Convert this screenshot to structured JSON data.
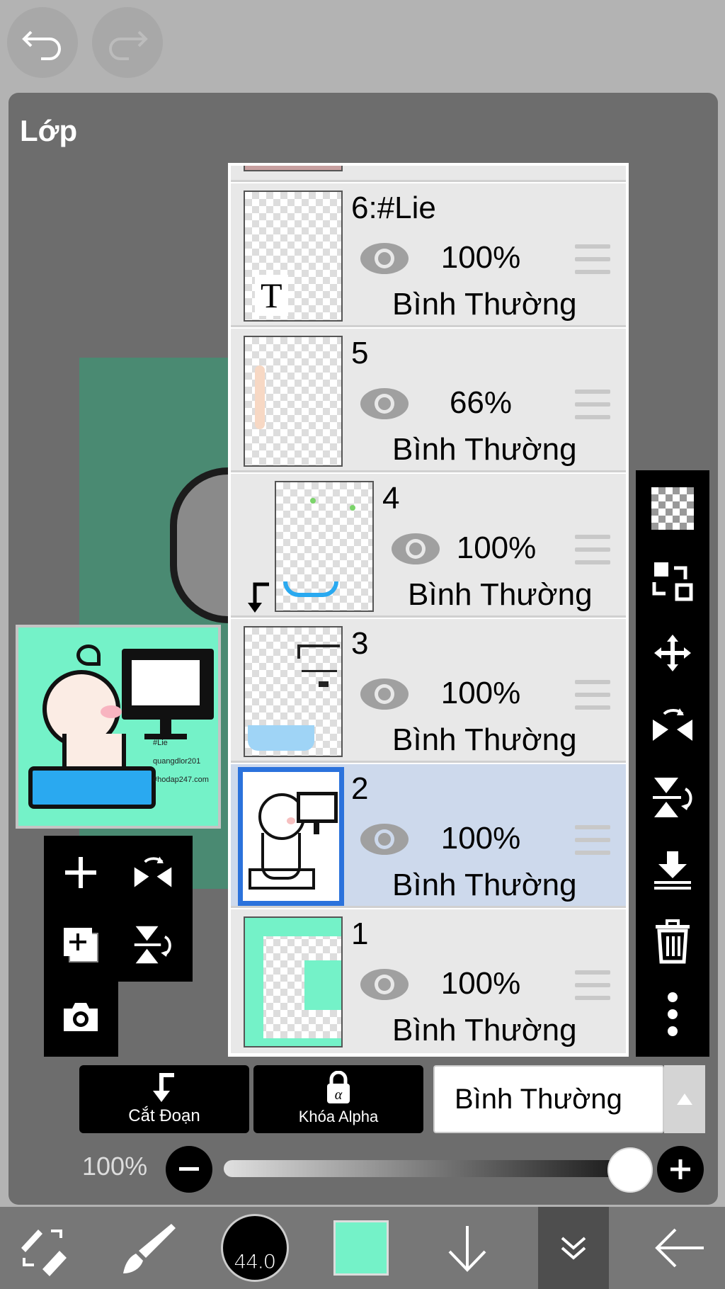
{
  "toolbar": {
    "undo_icon": "undo-icon",
    "redo_icon": "redo-icon"
  },
  "panel": {
    "title": "Lớp"
  },
  "layers": [
    {
      "name": "6:#Lie",
      "opacity": "100%",
      "blend": "Bình Thường",
      "selected": false,
      "clipped": false,
      "thumb_text": "T"
    },
    {
      "name": "5",
      "opacity": "66%",
      "blend": "Bình Thường",
      "selected": false,
      "clipped": false
    },
    {
      "name": "4",
      "opacity": "100%",
      "blend": "Bình Thường",
      "selected": false,
      "clipped": true
    },
    {
      "name": "3",
      "opacity": "100%",
      "blend": "Bình Thường",
      "selected": false,
      "clipped": false
    },
    {
      "name": "2",
      "opacity": "100%",
      "blend": "Bình Thường",
      "selected": true,
      "clipped": false
    },
    {
      "name": "1",
      "opacity": "100%",
      "blend": "Bình Thường",
      "selected": false,
      "clipped": false
    }
  ],
  "preview": {
    "lines": [
      "#Lie",
      "quangdlor201",
      "#hodap247.com"
    ]
  },
  "right_tools": [
    "checker-icon",
    "swap-icon",
    "move-icon",
    "flip-horizontal-icon",
    "flip-vertical-icon",
    "merge-down-icon",
    "trash-icon",
    "more-icon"
  ],
  "left_tools": [
    "add-layer-icon",
    "flip-h-icon",
    "duplicate-layer-icon",
    "flip-v-icon",
    "camera-icon"
  ],
  "buttons": {
    "clipping_label": "Cắt Đoạn",
    "alpha_lock_label": "Khóa Alpha",
    "blend_mode_value": "Bình Thường"
  },
  "opacity_slider": {
    "label": "100%",
    "value": 1.0
  },
  "bottom_bar": {
    "brush_size": "44.0",
    "color": "#74f2c8"
  }
}
